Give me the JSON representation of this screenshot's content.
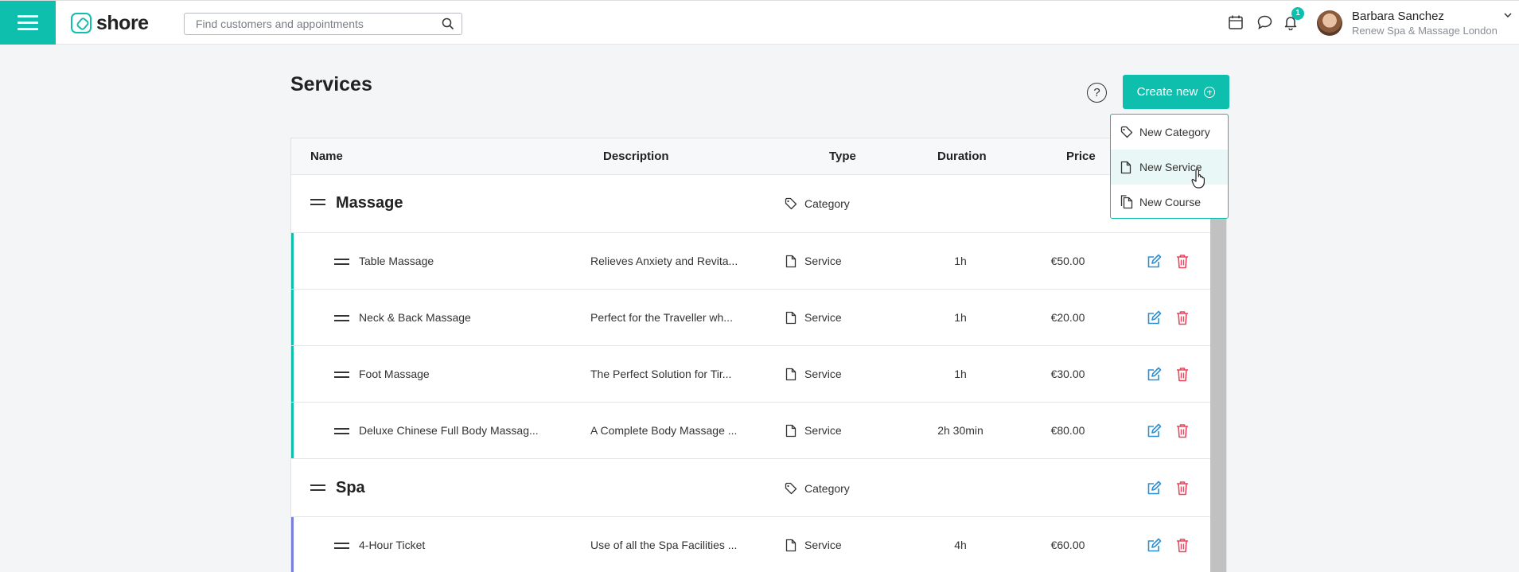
{
  "app": {
    "brand": "shore",
    "search_placeholder": "Find customers and appointments",
    "notifications_count": "1",
    "user": {
      "name": "Barbara Sanchez",
      "shop": "Renew Spa & Massage London"
    },
    "accent_color": "#0fbfae",
    "danger_color": "#e8455d",
    "edit_color": "#2b8fd6"
  },
  "page": {
    "title": "Services",
    "help_label": "?",
    "create_label": "Create new"
  },
  "create_menu": {
    "items": [
      {
        "label": "New Category",
        "icon": "tag-icon"
      },
      {
        "label": "New Service",
        "icon": "document-icon"
      },
      {
        "label": "New Course",
        "icon": "documents-icon"
      }
    ],
    "hovered": "New Service"
  },
  "table": {
    "columns": {
      "name": "Name",
      "description": "Description",
      "type": "Type",
      "duration": "Duration",
      "price": "Price"
    },
    "rows": [
      {
        "kind": "category",
        "name": "Massage",
        "type": "Category"
      },
      {
        "kind": "service",
        "name": "Table Massage",
        "description": "Relieves Anxiety and Revita...",
        "type": "Service",
        "duration": "1h",
        "price": "€50.00",
        "accent": "#0fbfae"
      },
      {
        "kind": "service",
        "name": "Neck & Back Massage",
        "description": "Perfect for the Traveller wh...",
        "type": "Service",
        "duration": "1h",
        "price": "€20.00",
        "accent": "#0fbfae"
      },
      {
        "kind": "service",
        "name": "Foot Massage",
        "description": "The Perfect Solution for Tir...",
        "type": "Service",
        "duration": "1h",
        "price": "€30.00",
        "accent": "#0fbfae"
      },
      {
        "kind": "service",
        "name": "Deluxe Chinese Full Body Massag...",
        "description": "A Complete Body Massage ...",
        "type": "Service",
        "duration": "2h 30min",
        "price": "€80.00",
        "accent": "#0fbfae"
      },
      {
        "kind": "category",
        "name": "Spa",
        "type": "Category"
      },
      {
        "kind": "service",
        "name": "4-Hour Ticket",
        "description": "Use of all the Spa Facilities ...",
        "type": "Service",
        "duration": "4h",
        "price": "€60.00",
        "accent": "#7b7fd9"
      }
    ]
  }
}
